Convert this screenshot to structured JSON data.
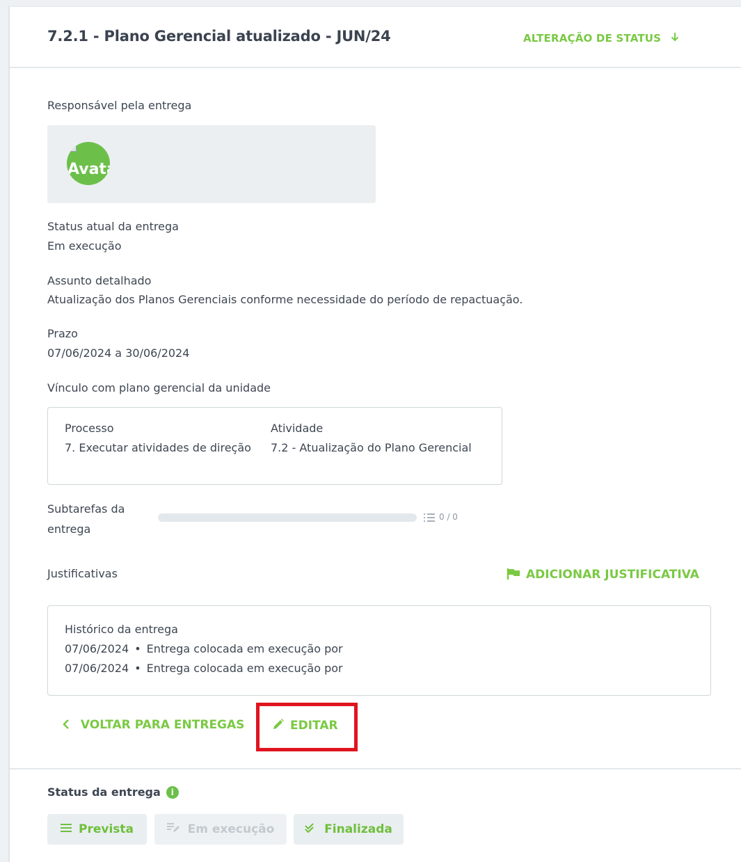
{
  "header": {
    "title": "7.2.1 - Plano Gerencial atualizado - JUN/24",
    "status_change_label": "ALTERAÇÃO DE STATUS",
    "status_change_icon": "arrow-down-icon"
  },
  "responsible": {
    "label": "Responsável pela entrega",
    "avatar_alt": "Avatar"
  },
  "status": {
    "label": "Status atual da entrega",
    "value": "Em execução"
  },
  "subject": {
    "label": "Assunto detalhado",
    "value": "Atualização dos Planos Gerenciais conforme necessidade do período de repactuação."
  },
  "deadline": {
    "label": "Prazo",
    "value": "07/06/2024 a 30/06/2024"
  },
  "link": {
    "label": "Vínculo com plano gerencial da unidade",
    "process_header": "Processo",
    "process_value": "7. Executar atividades de direção",
    "activity_header": "Atividade",
    "activity_value": "7.2 - Atualização do Plano Gerencial"
  },
  "subtasks": {
    "label": "Subtarefas da entrega",
    "count": "0 / 0",
    "progress": 0
  },
  "justifications": {
    "label": "Justificativas",
    "add_label": "ADICIONAR JUSTIFICATIVA",
    "add_icon": "flag-icon"
  },
  "history": {
    "title": "Histórico da entrega",
    "rows": [
      {
        "date": "07/06/2024",
        "text": "Entrega colocada em execução por"
      },
      {
        "date": "07/06/2024",
        "text": "Entrega colocada em execução por"
      }
    ]
  },
  "actions": {
    "back_label": "VOLTAR PARA ENTREGAS",
    "edit_label": "EDITAR"
  },
  "status_buttons": {
    "title": "Status da entrega",
    "info_icon": "info-icon",
    "items": [
      {
        "label": "Prevista",
        "icon": "list-icon",
        "disabled": false
      },
      {
        "label": "Em execução",
        "icon": "edit-note-icon",
        "disabled": true
      },
      {
        "label": "Finalizada",
        "icon": "double-check-icon",
        "disabled": false
      }
    ]
  },
  "colors": {
    "accent": "#7ac943",
    "highlight_border": "#e0141e"
  }
}
